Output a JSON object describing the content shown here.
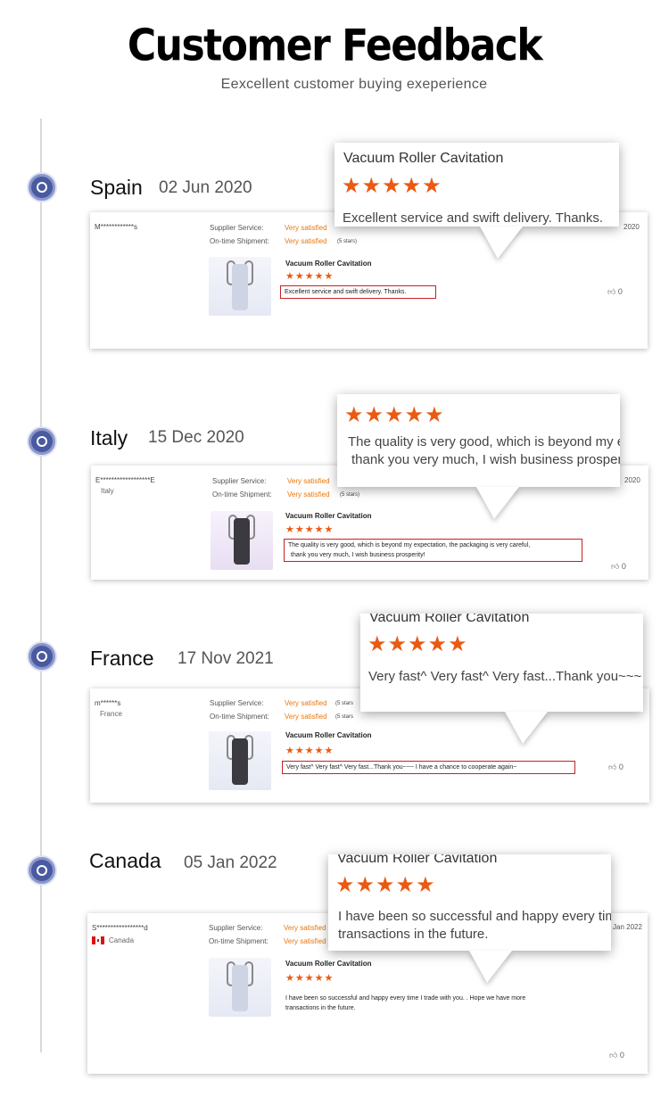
{
  "header": {
    "title": "Customer Feedback",
    "subtitle": "Eexcellent customer buying exeperience"
  },
  "colors": {
    "accent": "#ea5a12",
    "timeline_dot": "#4a5aa0",
    "highlight_border": "#c62020"
  },
  "reviews": [
    {
      "country": "Spain",
      "date": "02 Jun 2020",
      "user": "M************s",
      "region": "",
      "supplier_service_label": "Supplier Service:",
      "supplier_service_value": "Very satisfied",
      "shipment_label": "On-time Shipment:",
      "shipment_value": "Very satisfied",
      "shipment_stars": "(5 stars)",
      "product": "Vacuum Roller Cavitation",
      "rating": 5,
      "stars": "★★★★★",
      "message": "Excellent service and swift delivery. Thanks.",
      "likes": "0",
      "card_date": "2020",
      "bubble": {
        "title": "Vacuum Roller Cavitation",
        "stars": "★★★★★",
        "text": "Excellent service and swift delivery. Thanks."
      }
    },
    {
      "country": "Italy",
      "date": "15 Dec 2020",
      "user": "E******************E",
      "region": "Italy",
      "supplier_service_label": "Supplier Service:",
      "supplier_service_value": "Very satisfied",
      "shipment_label": "On-time Shipment:",
      "shipment_value": "Very satisfied",
      "shipment_stars": "(5 stars)",
      "product": "Vacuum Roller Cavitation",
      "rating": 5,
      "stars": "★★★★★",
      "message_line1": "The quality is very good, which is beyond my expectation, the packaging is very careful,",
      "message_line2": "thank you very much, I wish business prosperity!",
      "likes": "0",
      "card_date": "2020",
      "bubble": {
        "stars": "★★★★★",
        "text_line1": "The quality is very good, which is beyond my expectation,",
        "text_line2": "thank you very much, I wish business prosperity!"
      }
    },
    {
      "country": "France",
      "date": "17 Nov 2021",
      "user": "m******s",
      "region": "France",
      "supplier_service_label": "Supplier Service:",
      "supplier_service_value": "Very satisfied",
      "supplier_service_stars": "(5 stars",
      "shipment_label": "On-time Shipment:",
      "shipment_value": "Very satisfied",
      "shipment_stars": "(5 stars",
      "product": "Vacuum Roller Cavitation",
      "rating": 5,
      "stars": "★★★★★",
      "message": "Very fast^ Very fast^ Very fast...Thank you~~~ I have a chance to cooperate again~",
      "likes": "0",
      "bubble": {
        "title": "Vacuum Roller Cavitation",
        "stars": "★★★★★",
        "text": "Very fast^ Very fast^ Very fast...Thank you~~~"
      }
    },
    {
      "country": "Canada",
      "date": "05 Jan 2022",
      "user": "S*****************d",
      "region": "Canada",
      "supplier_service_label": "Supplier Service:",
      "supplier_service_value": "Very satisfied",
      "shipment_label": "On-time Shipment:",
      "shipment_value": "Very satisfied",
      "product": "Vacuum Roller Cavitation",
      "rating": 5,
      "stars": "★★★★★",
      "message_line1": "I have been so successful and happy every time I trade with you. . Hope we have more",
      "message_line2": "transactions in the future.",
      "likes": "0",
      "card_date": "Jan 2022",
      "bubble": {
        "title": "Vacuum Roller Cavitation",
        "stars": "★★★★★",
        "text_line1": "I have been so successful and happy every time",
        "text_line2": "transactions in the future."
      }
    }
  ]
}
